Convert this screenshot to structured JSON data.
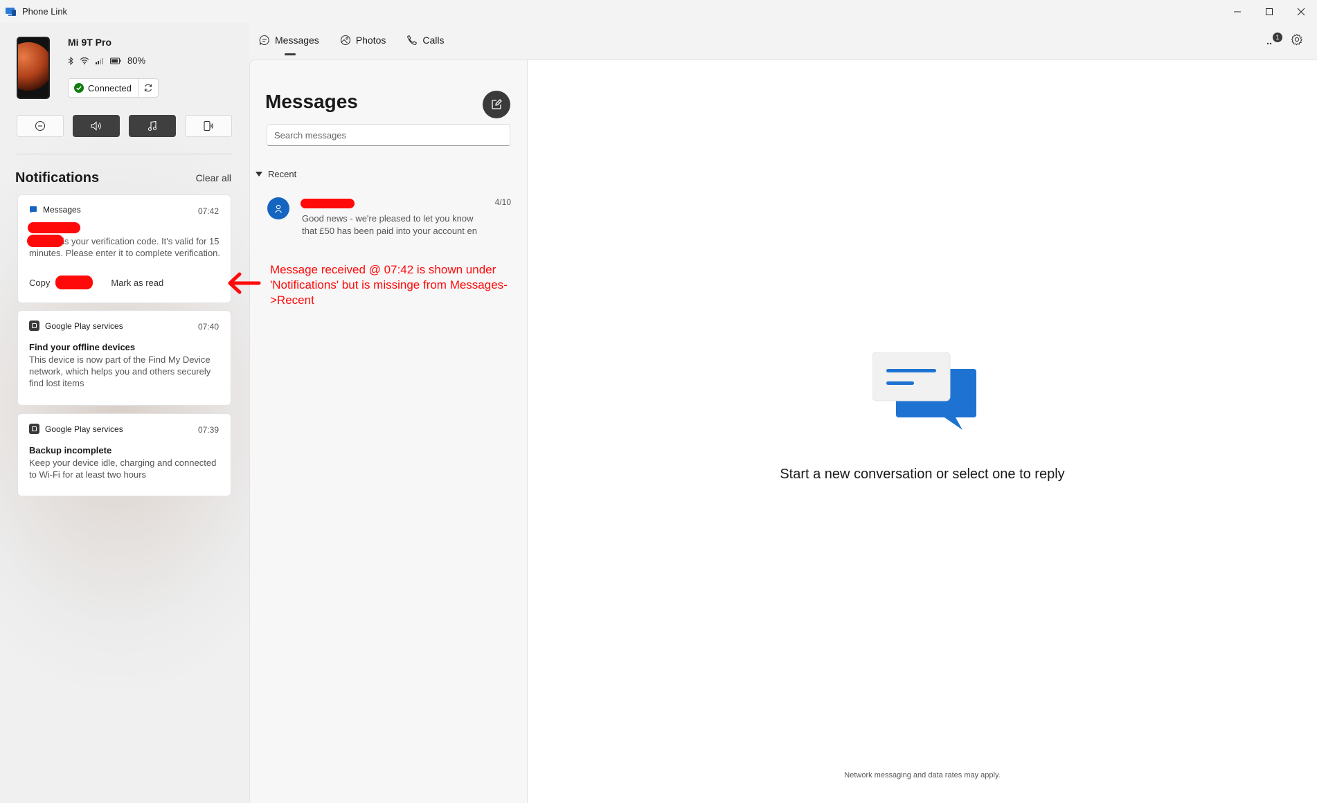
{
  "window": {
    "title": "Phone Link"
  },
  "device": {
    "name": "Mi 9T Pro",
    "battery": "80%",
    "status": "Connected"
  },
  "notifications": {
    "title": "Notifications",
    "clear_all": "Clear all",
    "items": [
      {
        "app": "Messages",
        "time": "07:42",
        "body": "is your verification code. It's valid for 15 minutes. Please enter it to complete verification.",
        "action_copy": "Copy",
        "action_mark": "Mark as read"
      },
      {
        "app": "Google Play services",
        "time": "07:40",
        "title": "Find your offline devices",
        "body": "This device is now part of the Find My Device network, which helps you and others securely find lost items"
      },
      {
        "app": "Google Play services",
        "time": "07:39",
        "title": "Backup incomplete",
        "body": "Keep your device idle, charging and connected to Wi-Fi for at least two hours"
      }
    ]
  },
  "nav": {
    "tabs": [
      {
        "label": "Messages",
        "selected": true
      },
      {
        "label": "Photos",
        "selected": false
      },
      {
        "label": "Calls",
        "selected": false
      }
    ],
    "badge_count": "1"
  },
  "messages": {
    "title": "Messages",
    "search_placeholder": "Search messages",
    "recent_label": "Recent",
    "conversations": [
      {
        "date": "4/10",
        "preview": "Good news - we're pleased to let you know that £50 has been paid into your account en"
      }
    ]
  },
  "annotation": {
    "text": "Message received  @ 07:42 is shown under 'Notifications' but is missinge from Messages->Recent",
    "color": "#ff0a0a"
  },
  "empty_state": {
    "title": "Start a new conversation or select one to reply",
    "footer": "Network messaging and data rates may apply."
  },
  "colors": {
    "accent": "#1565c0",
    "connected": "#107c10",
    "redaction": "#ff0a0a"
  }
}
